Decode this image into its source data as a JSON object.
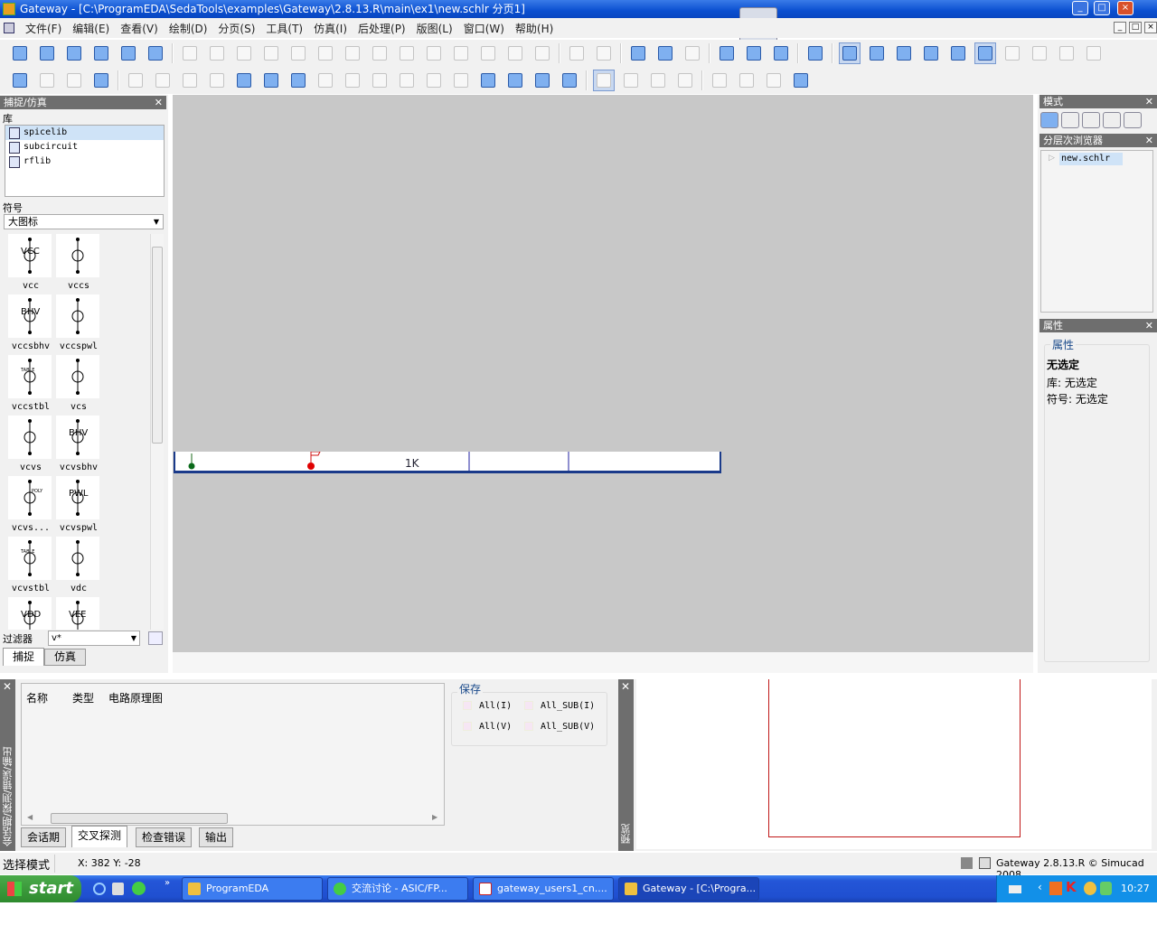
{
  "window": {
    "title": "Gateway - [C:\\ProgramEDA\\SedaTools\\examples\\Gateway\\2.8.13.R\\main\\ex1\\new.schlr 分页1]",
    "controls": [
      "_",
      "□",
      "×"
    ]
  },
  "menu": [
    "文件(F)",
    "编辑(E)",
    "查看(V)",
    "绘制(D)",
    "分页(S)",
    "工具(T)",
    "仿真(I)",
    "后处理(P)",
    "版图(L)",
    "窗口(W)",
    "帮助(H)"
  ],
  "toolbar1": [
    "new-sheet-icon",
    "new-library-icon",
    "new-symbol-icon",
    "save-icon",
    "export-icon",
    "print-icon",
    "|",
    "cut-icon",
    "copy-icon",
    "paste-icon",
    "delete-icon",
    "undo-icon",
    "redo-icon",
    "mirror-h-icon",
    "mirror-v-icon",
    "edit-icon",
    "align-left-icon",
    "align-right-icon",
    "text-larger-icon",
    "text-smaller-icon",
    "text-icon",
    "|",
    "back-icon",
    "forward-icon",
    "|",
    "wire-hierarchy-icon",
    "probe-icon",
    "grid-icon",
    "|",
    "sheet-prev-icon",
    "sheet-next-icon",
    "sheet-window-icon",
    "|",
    "help-lifebuoy-icon",
    "|",
    "select-arrow-icon",
    "zoom-box-icon",
    "zoom-in-icon",
    "zoom-out-icon",
    "zoom-fit-icon",
    "zoom-select-icon",
    "info-icon",
    "tool1-icon",
    "tool2-icon",
    "tool3-icon"
  ],
  "toolbar2": [
    "wire-pencil-icon",
    "bus-pencil-icon",
    "port-icon",
    "text-A-icon",
    "|",
    "check-icon",
    "check2-icon",
    "check3-icon",
    "find-icon",
    "netlist-icon",
    "edit-netlist-icon",
    "simulate-icon",
    "dc-icon",
    "ac-icon",
    "transient-icon",
    "op-icon",
    "report-icon",
    "table-icon",
    "probe2-icon",
    "voltage-V-icon",
    "current-I-icon",
    "params-icon",
    "|",
    "vi-icon",
    "db-icon",
    "graph-icon",
    "delta-icon",
    "|",
    "tool4-icon",
    "tool5-icon",
    "tool6-icon",
    "color-wheel-icon"
  ],
  "left_panel": {
    "title": "捕捉/仿真",
    "lib_label": "库",
    "libraries": [
      "spicelib",
      "subcircuit",
      "rflib"
    ],
    "symbol_label": "符号",
    "view_select": "大图标",
    "symbols": [
      {
        "name": "vcc",
        "tag": "VCC"
      },
      {
        "name": "vccs",
        "tag": ""
      },
      {
        "name": "vccsbhv",
        "tag": "BHV"
      },
      {
        "name": "vccspwl",
        "tag": ""
      },
      {
        "name": "vccstbl",
        "tag": "TABLE"
      },
      {
        "name": "vcs",
        "tag": ""
      },
      {
        "name": "vcvs",
        "tag": ""
      },
      {
        "name": "vcvsbhv",
        "tag": "BHV"
      },
      {
        "name": "vcvs...",
        "tag": "POLY"
      },
      {
        "name": "vcvspwl",
        "tag": "PWL"
      },
      {
        "name": "vcvstbl",
        "tag": "TABLE"
      },
      {
        "name": "vdc",
        "tag": ""
      },
      {
        "name": "",
        "tag": "VDD"
      },
      {
        "name": "",
        "tag": "VEE"
      }
    ],
    "filter_label": "过滤器",
    "filter_value": "v*",
    "tabs": [
      "捕捉",
      "仿真"
    ]
  },
  "canvas": {
    "resistor_label": "1K"
  },
  "right_panel": {
    "mode_title": "模式",
    "mode_icons": [
      "select-mode-icon",
      "probe-mode-icon",
      "waveform-mode-icon",
      "param-mode-icon",
      "layout-mode-icon"
    ],
    "hier_title": "分层次浏览器",
    "hier_items": [
      "new.schlr"
    ],
    "prop_title": "属性",
    "prop_group": "属性",
    "prop_none": "无选定",
    "prop_lib": "库: 无选定",
    "prop_sym": "符号: 无选定"
  },
  "bottom_panel": {
    "side_label": "会话期/探测/错误/输出",
    "columns": [
      "名称",
      "类型",
      "电路原理图"
    ],
    "save_title": "保存",
    "save_options": [
      "All(I)",
      "All_SUB(I)",
      "All(V)",
      "All_SUB(V)"
    ],
    "tabs": [
      "会话期",
      "交叉探测",
      "检查错误",
      "输出"
    ],
    "active_tab": 1,
    "preview_label": "预览"
  },
  "status": {
    "mode": "选择模式",
    "coords": "X: 382 Y: -28",
    "app": "Gateway 2.8.13.R © Simucad 2008"
  },
  "taskbar": {
    "start": "start",
    "tasks": [
      "ProgramEDA",
      "交流讨论 - ASIC/FP...",
      "gateway_users1_cn....",
      "Gateway - [C:\\Progra..."
    ],
    "clock": "10:27"
  },
  "colors": {
    "title_bar": "#0a4fd0",
    "panel_header": "#6e6e6e",
    "canvas": "#c8c8c8",
    "schematic_border": "#1a3a8a"
  }
}
